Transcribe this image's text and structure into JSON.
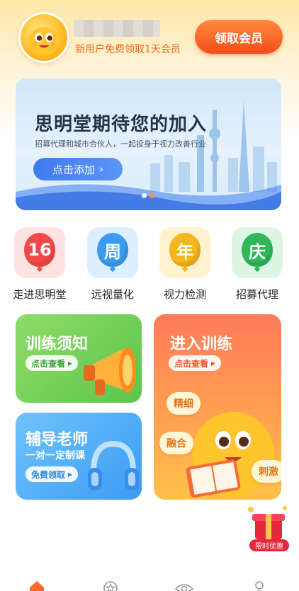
{
  "header": {
    "promo_text": "新用户免费领取1天会员",
    "vip_button": "领取会员"
  },
  "banner": {
    "title": "思明堂期待您的加入",
    "subtitle": "招募代理和城市合伙人，一起投身于视力改善行业",
    "button": "点击添加",
    "slide_index": 2,
    "slide_count": 2
  },
  "menu": {
    "items": [
      {
        "glyph": "16",
        "label": "走进思明堂",
        "color": "#F24848",
        "bg": "#FFE3E3"
      },
      {
        "glyph": "周",
        "label": "远视量化",
        "color": "#3B9BF0",
        "bg": "#DDEFFF"
      },
      {
        "glyph": "年",
        "label": "视力检测",
        "color": "#F5B51E",
        "bg": "#FFF2CF"
      },
      {
        "glyph": "庆",
        "label": "招募代理",
        "color": "#2FB75A",
        "bg": "#DDF6E3"
      }
    ]
  },
  "cards": {
    "training_notice": {
      "title": "训练须知",
      "button": "点击查看"
    },
    "enter_training": {
      "title": "进入训练",
      "button": "点击查看",
      "tags": [
        "精细",
        "融合",
        "刺激"
      ]
    },
    "tutor": {
      "title": "辅导老师",
      "subtitle": "一对一定制课",
      "button": "免费领取"
    }
  },
  "float_promo": {
    "label": "限时优惠"
  },
  "colors": {
    "accent": "#F34D1B",
    "brand_orange": "#FF8A3D"
  }
}
